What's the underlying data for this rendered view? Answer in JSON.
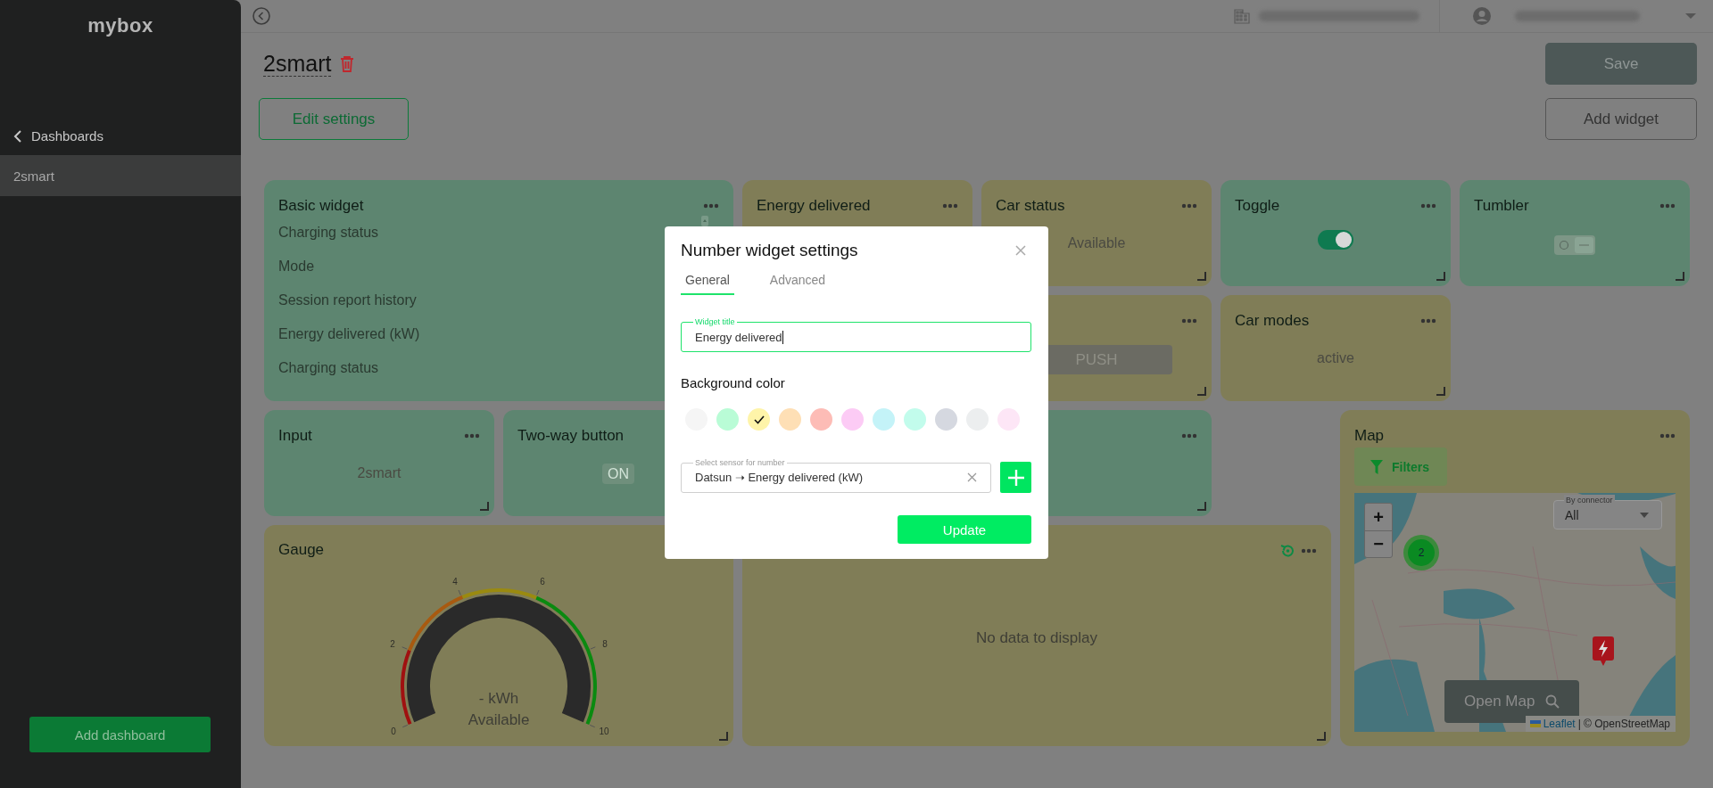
{
  "sidebar": {
    "logo": "mybox",
    "back_link": "Dashboards",
    "items": [
      {
        "label": "2smart",
        "selected": true
      }
    ],
    "add_button": "Add dashboard"
  },
  "dashboard": {
    "title": "2smart",
    "edit_button": "Edit settings",
    "save_button": "Save",
    "add_widget_button": "Add widget"
  },
  "widgets": [
    {
      "kind": "list",
      "title": "Basic widget",
      "color": "#5d8570",
      "rows": [
        "Charging status",
        "Mode",
        "Session report history",
        "Energy delivered (kW)",
        "Charging status"
      ]
    },
    {
      "kind": "number",
      "title": "Energy delivered",
      "color": "#807d57"
    },
    {
      "kind": "text",
      "title": "Car status",
      "color": "#807d57",
      "value": "Available"
    },
    {
      "kind": "toggle",
      "title": "Toggle",
      "color": "#5d8570",
      "on": true
    },
    {
      "kind": "tumbler",
      "title": "Tumbler",
      "color": "#5d8570"
    },
    {
      "kind": "push",
      "color": "#807d57",
      "button": "PUSH"
    },
    {
      "kind": "text",
      "title": "Car modes",
      "color": "#807d57",
      "value": "active"
    },
    {
      "kind": "text",
      "title": "Input",
      "color": "#5d8570",
      "value": "2smart"
    },
    {
      "kind": "twoway",
      "title": "Two-way button",
      "color": "#5d8570",
      "button": "ON"
    },
    {
      "kind": "blank",
      "color": "#5d8570"
    },
    {
      "kind": "map",
      "title": "Map",
      "color": "#807d57",
      "filters": "Filters",
      "connector_label": "By connector",
      "connector_value": "All",
      "cluster_count": "2",
      "zoom_in": "+",
      "zoom_out": "−",
      "open_map": "Open Map",
      "attribution_link": "Leaflet",
      "attribution_text": "| © OpenStreetMap"
    },
    {
      "kind": "gauge",
      "title": "Gauge",
      "color": "#807d57",
      "ticks": [
        "0",
        "2",
        "4",
        "6",
        "8",
        "10"
      ],
      "value": "- kWh",
      "status": "Available"
    },
    {
      "kind": "chart",
      "color": "#807d57",
      "empty_text": "No data to display"
    }
  ],
  "modal": {
    "title": "Number widget settings",
    "tabs": [
      {
        "label": "General",
        "selected": true
      },
      {
        "label": "Advanced",
        "selected": false
      }
    ],
    "title_field": {
      "label": "Widget title",
      "value": "Energy delivered"
    },
    "background_label": "Background color",
    "swatches": [
      {
        "color": "#f5f5f5",
        "selected": false
      },
      {
        "color": "#b9fcd6",
        "selected": false
      },
      {
        "color": "#fef4a9",
        "selected": true
      },
      {
        "color": "#fedfb5",
        "selected": false
      },
      {
        "color": "#fdbcb6",
        "selected": false
      },
      {
        "color": "#fccbf5",
        "selected": false
      },
      {
        "color": "#c4f3f8",
        "selected": false
      },
      {
        "color": "#c2fcec",
        "selected": false
      },
      {
        "color": "#d5d8e0",
        "selected": false
      },
      {
        "color": "#eceeef",
        "selected": false
      },
      {
        "color": "#fde6f6",
        "selected": false
      }
    ],
    "sensor_field": {
      "label": "Select sensor for number",
      "value": "Datsun ➝ Energy delivered (kW)"
    },
    "update_button": "Update"
  }
}
